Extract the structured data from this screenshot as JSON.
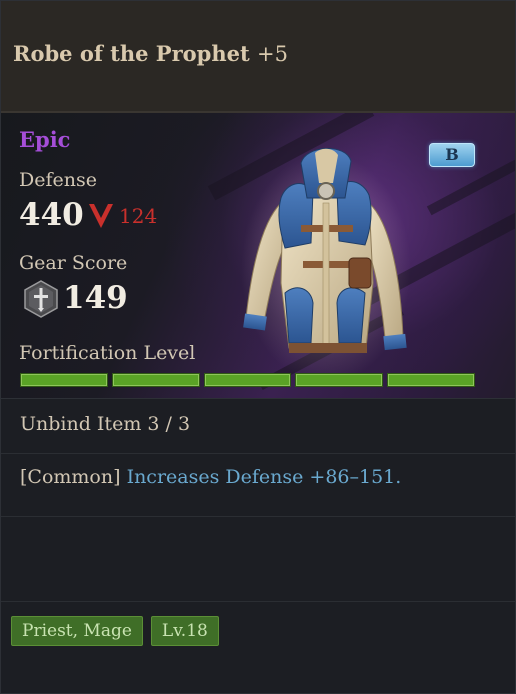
{
  "item": {
    "name": "Robe of the Prophet",
    "enhance": "+5",
    "grade": "Epic",
    "grade_color": "#a54ed8",
    "badge": "B",
    "image_icon": "robe-armor-icon"
  },
  "stats": {
    "defense_label": "Defense",
    "defense_value": "440",
    "defense_diff": "124",
    "defense_diff_direction": "down",
    "gear_score_label": "Gear Score",
    "gear_score_value": "149",
    "fortification_label": "Fortification Level",
    "fortification_filled": 5,
    "fortification_total": 5
  },
  "unbind": "Unbind Item 3 / 3",
  "effect": {
    "tag": "[Common]",
    "text": "Increases Defense +86–151."
  },
  "tags": [
    "Priest, Mage",
    "Lv.18"
  ],
  "colors": {
    "accent_green": "#5aa326",
    "decrease_red": "#c9302c",
    "effect_blue": "#6aa9cf"
  }
}
